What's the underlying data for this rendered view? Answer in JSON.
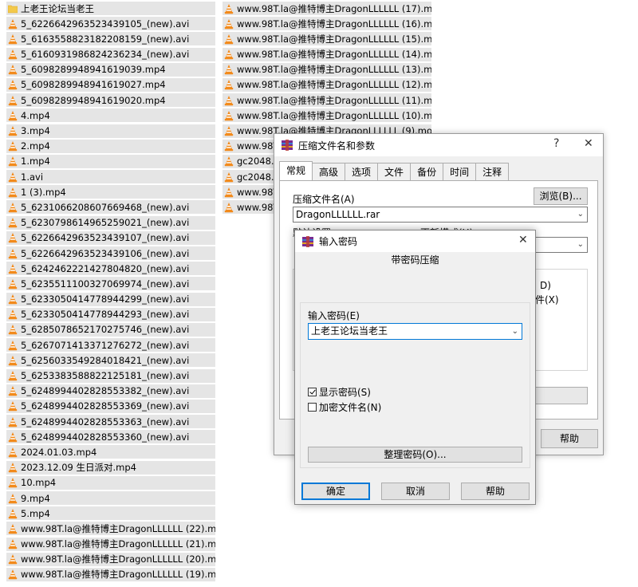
{
  "file_list": {
    "left_column": [
      {
        "name": "上老王论坛当老王",
        "type": "folder"
      },
      {
        "name": "5_6226642963523439105_(new).avi",
        "type": "vlc"
      },
      {
        "name": "5_6163558823182208159_(new).avi",
        "type": "vlc"
      },
      {
        "name": "5_6160931986824236234_(new).avi",
        "type": "vlc"
      },
      {
        "name": "5_6098289948941619039.mp4",
        "type": "vlc"
      },
      {
        "name": "5_6098289948941619027.mp4",
        "type": "vlc"
      },
      {
        "name": "5_6098289948941619020.mp4",
        "type": "vlc"
      },
      {
        "name": "4.mp4",
        "type": "vlc"
      },
      {
        "name": "3.mp4",
        "type": "vlc"
      },
      {
        "name": "2.mp4",
        "type": "vlc"
      },
      {
        "name": "1.mp4",
        "type": "vlc"
      },
      {
        "name": "1.avi",
        "type": "vlc"
      },
      {
        "name": "1 (3).mp4",
        "type": "vlc"
      },
      {
        "name": "5_6231066208607669468_(new).avi",
        "type": "vlc"
      },
      {
        "name": "5_6230798614965259021_(new).avi",
        "type": "vlc"
      },
      {
        "name": "5_6226642963523439107_(new).avi",
        "type": "vlc"
      },
      {
        "name": "5_6226642963523439106_(new).avi",
        "type": "vlc"
      },
      {
        "name": "5_6242462221427804820_(new).avi",
        "type": "vlc"
      },
      {
        "name": "5_6235511100327069974_(new).avi",
        "type": "vlc"
      },
      {
        "name": "5_6233050414778944299_(new).avi",
        "type": "vlc"
      },
      {
        "name": "5_6233050414778944293_(new).avi",
        "type": "vlc"
      },
      {
        "name": "5_6285078652170275746_(new).avi",
        "type": "vlc"
      },
      {
        "name": "5_6267071413371276272_(new).avi",
        "type": "vlc"
      },
      {
        "name": "5_6256033549284018421_(new).avi",
        "type": "vlc"
      },
      {
        "name": "5_6253383588822125181_(new).avi",
        "type": "vlc"
      },
      {
        "name": "5_6248994402828553382_(new).avi",
        "type": "vlc"
      },
      {
        "name": "5_6248994402828553369_(new).avi",
        "type": "vlc"
      },
      {
        "name": "5_6248994402828553363_(new).avi",
        "type": "vlc"
      },
      {
        "name": "5_6248994402828553360_(new).avi",
        "type": "vlc"
      },
      {
        "name": "2024.01.03.mp4",
        "type": "vlc"
      },
      {
        "name": "2023.12.09 生日派对.mp4",
        "type": "vlc"
      },
      {
        "name": "10.mp4",
        "type": "vlc"
      },
      {
        "name": "9.mp4",
        "type": "vlc"
      },
      {
        "name": "5.mp4",
        "type": "vlc"
      },
      {
        "name": "www.98T.la@推特博主DragonLLLLLL (22).mov",
        "type": "vlc"
      },
      {
        "name": "www.98T.la@推特博主DragonLLLLLL (21).mov",
        "type": "vlc"
      },
      {
        "name": "www.98T.la@推特博主DragonLLLLLL (20).mov",
        "type": "vlc"
      },
      {
        "name": "www.98T.la@推特博主DragonLLLLLL (19).mov",
        "type": "vlc"
      }
    ],
    "right_column": [
      {
        "name": "www.98T.la@推特博主DragonLLLLLL (17).mov",
        "type": "vlc"
      },
      {
        "name": "www.98T.la@推特博主DragonLLLLLL (16).mov",
        "type": "vlc"
      },
      {
        "name": "www.98T.la@推特博主DragonLLLLLL (15).mov",
        "type": "vlc"
      },
      {
        "name": "www.98T.la@推特博主DragonLLLLLL (14).mov",
        "type": "vlc"
      },
      {
        "name": "www.98T.la@推特博主DragonLLLLLL (13).mov",
        "type": "vlc"
      },
      {
        "name": "www.98T.la@推特博主DragonLLLLLL (12).mov",
        "type": "vlc"
      },
      {
        "name": "www.98T.la@推特博主DragonLLLLLL (11).mov",
        "type": "vlc"
      },
      {
        "name": "www.98T.la@推特博主DragonLLLLLL (10).mov",
        "type": "vlc"
      },
      {
        "name": "www.98T.la@推特博主DragonLLLLLL (9).mov",
        "type": "vlc"
      },
      {
        "name": "www.98T",
        "type": "vlc"
      },
      {
        "name": "gc2048.c",
        "type": "vlc"
      },
      {
        "name": "gc2048.c",
        "type": "vlc"
      },
      {
        "name": "www.98T",
        "type": "vlc"
      },
      {
        "name": "www.98T",
        "type": "vlc"
      }
    ]
  },
  "archive_dialog": {
    "title": "压缩文件名和参数",
    "help_glyph": "?",
    "close_glyph": "✕",
    "tabs": [
      "常规",
      "高级",
      "选项",
      "文件",
      "备份",
      "时间",
      "注释"
    ],
    "archive_name_label": "压缩文件名(A)",
    "browse_button": "浏览(B)...",
    "archive_name_value": "DragonLLLLLL.rar",
    "partial_label_left": "默认设置",
    "partial_label_right": "更新模式(U)",
    "partial_text_1": "D)",
    "partial_text_2": "件(X)",
    "help_button": "帮助"
  },
  "password_dialog": {
    "title": "输入密码",
    "close_glyph": "✕",
    "heading": "带密码压缩",
    "password_label": "输入密码(E)",
    "password_value": "上老王论坛当老王",
    "show_password_label": "显示密码(S)",
    "show_password_checked": true,
    "encrypt_names_label": "加密文件名(N)",
    "encrypt_names_checked": false,
    "organize_button": "整理密码(O)...",
    "ok_button": "确定",
    "cancel_button": "取消",
    "help_button": "帮助"
  }
}
